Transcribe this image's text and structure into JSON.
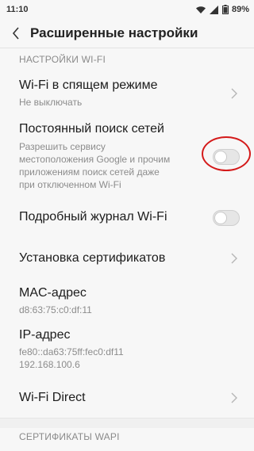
{
  "status_bar": {
    "time": "11:10",
    "battery": "89%",
    "icons": [
      "wifi-icon",
      "signal-icon",
      "battery-icon"
    ]
  },
  "header": {
    "back_icon": "chevron-left-icon",
    "title": "Расширенные настройки"
  },
  "sections": [
    {
      "title": "НАСТРОЙКИ WI-FI"
    },
    {
      "title": "СЕРТИФИКАТЫ WAPI"
    }
  ],
  "items": {
    "sleep": {
      "title": "Wi-Fi в спящем режиме",
      "subtitle": "Не выключать"
    },
    "scan": {
      "title": "Постоянный поиск сетей",
      "subtitle_lines": [
        "Разрешить сервису",
        "местоположения Google и прочим",
        "приложениям поиск сетей даже",
        "при отключенном Wi-Fi"
      ],
      "enabled": false
    },
    "log": {
      "title": "Подробный журнал Wi-Fi",
      "enabled": false
    },
    "certs": {
      "title": "Установка сертификатов"
    },
    "mac": {
      "title": "MAC-адрес",
      "value": "d8:63:75:c0:df:11"
    },
    "ip": {
      "title": "IP-адрес",
      "value_lines": [
        "fe80::da63:75ff:fec0:df11",
        "192.168.100.6"
      ]
    },
    "direct": {
      "title": "Wi-Fi Direct"
    }
  },
  "colors": {
    "accent_ring": "#d41a1a",
    "background": "#f7f7f7",
    "secondary_text": "#8c8c8c"
  }
}
